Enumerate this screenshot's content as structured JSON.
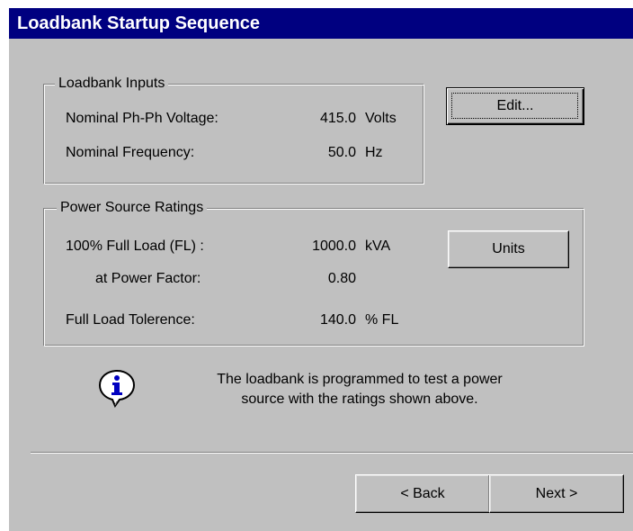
{
  "window": {
    "title": "Loadbank Startup Sequence"
  },
  "loadbank_inputs": {
    "label": "Loadbank Inputs",
    "rows": [
      {
        "label": "Nominal Ph-Ph Voltage:",
        "value": "415.0",
        "unit": "Volts"
      },
      {
        "label": "Nominal Frequency:",
        "value": "50.0",
        "unit": "Hz"
      }
    ],
    "edit_button": {
      "label": "Edit..."
    }
  },
  "power_source_ratings": {
    "label": "Power Source Ratings",
    "rows": [
      {
        "label": "100% Full Load (FL) :",
        "value": "1000.0",
        "unit": "kVA"
      },
      {
        "label": "at Power Factor:",
        "value": "0.80",
        "unit": ""
      },
      {
        "label": "Full Load Tolerence:",
        "value": "140.0",
        "unit": "% FL"
      }
    ],
    "units_button": {
      "label": "Units"
    }
  },
  "info": {
    "icon": "info-icon",
    "line1": "The loadbank is programmed to test a power",
    "line2": "source with the ratings shown above."
  },
  "footer": {
    "back_label": "< Back",
    "next_label": "Next >"
  }
}
